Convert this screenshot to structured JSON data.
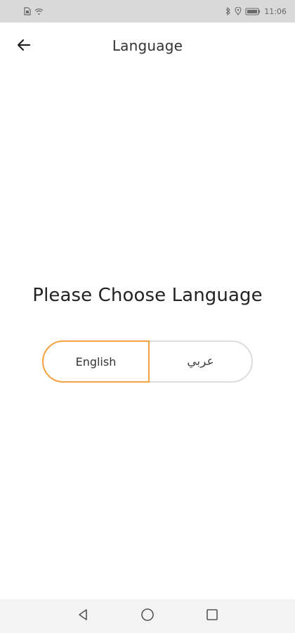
{
  "status_bar": {
    "time": "11:06",
    "left_icons": [
      "sim-icon",
      "wifi-icon"
    ],
    "right_icons": [
      "bluetooth-icon",
      "location-icon",
      "battery-icon"
    ]
  },
  "app_bar": {
    "title": "Language",
    "back_icon": "arrow-left-icon"
  },
  "main": {
    "prompt": "Please Choose Language",
    "options": [
      {
        "label": "English",
        "selected": true
      },
      {
        "label": "عربي",
        "selected": false
      }
    ]
  },
  "nav_bar": {
    "buttons": [
      "back-triangle-icon",
      "home-circle-icon",
      "recent-square-icon"
    ]
  },
  "colors": {
    "accent": "#f5a341",
    "status_bar_bg": "#d9d9d9",
    "nav_bar_bg": "#f3f3f3",
    "border": "#dddddd"
  }
}
